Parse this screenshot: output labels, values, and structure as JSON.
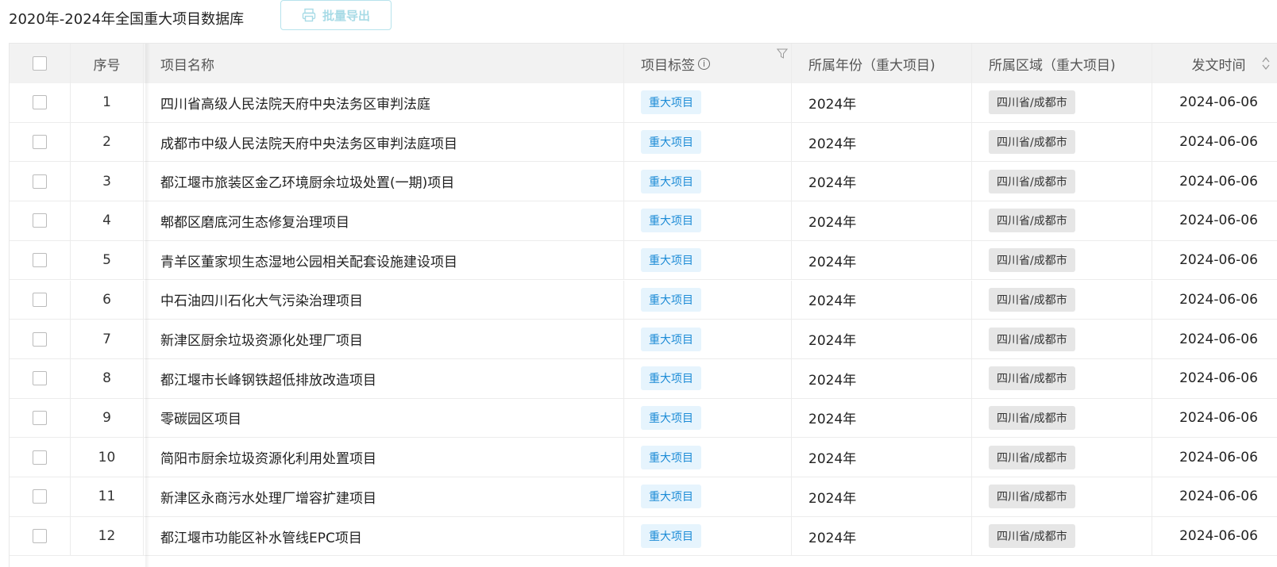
{
  "page": {
    "title": "2020年-2024年全国重大项目数据库",
    "export_label": "批量导出"
  },
  "table": {
    "headers": {
      "index": "序号",
      "name": "项目名称",
      "tag": "项目标签",
      "year": "所属年份（重大项目)",
      "region": "所属区域（重大项目)",
      "date": "发文时间"
    },
    "rows": [
      {
        "index": "1",
        "name": "四川省高级人民法院天府中央法务区审判法庭",
        "tag": "重大项目",
        "year": "2024年",
        "region": "四川省/成都市",
        "date": "2024-06-06"
      },
      {
        "index": "2",
        "name": "成都市中级人民法院天府中央法务区审判法庭项目",
        "tag": "重大项目",
        "year": "2024年",
        "region": "四川省/成都市",
        "date": "2024-06-06"
      },
      {
        "index": "3",
        "name": "都江堰市旅装区金乙环境厨余垃圾处置(一期)项目",
        "tag": "重大项目",
        "year": "2024年",
        "region": "四川省/成都市",
        "date": "2024-06-06"
      },
      {
        "index": "4",
        "name": "郫都区磨底河生态修复治理项目",
        "tag": "重大项目",
        "year": "2024年",
        "region": "四川省/成都市",
        "date": "2024-06-06"
      },
      {
        "index": "5",
        "name": "青羊区董家坝生态湿地公园相关配套设施建设项目",
        "tag": "重大项目",
        "year": "2024年",
        "region": "四川省/成都市",
        "date": "2024-06-06"
      },
      {
        "index": "6",
        "name": "中石油四川石化大气污染治理项目",
        "tag": "重大项目",
        "year": "2024年",
        "region": "四川省/成都市",
        "date": "2024-06-06"
      },
      {
        "index": "7",
        "name": "新津区厨余垃圾资源化处理厂项目",
        "tag": "重大项目",
        "year": "2024年",
        "region": "四川省/成都市",
        "date": "2024-06-06"
      },
      {
        "index": "8",
        "name": "都江堰市长峰钢铁超低排放改造项目",
        "tag": "重大项目",
        "year": "2024年",
        "region": "四川省/成都市",
        "date": "2024-06-06"
      },
      {
        "index": "9",
        "name": "零碳园区项目",
        "tag": "重大项目",
        "year": "2024年",
        "region": "四川省/成都市",
        "date": "2024-06-06"
      },
      {
        "index": "10",
        "name": "简阳市厨余垃圾资源化利用处置项目",
        "tag": "重大项目",
        "year": "2024年",
        "region": "四川省/成都市",
        "date": "2024-06-06"
      },
      {
        "index": "11",
        "name": "新津区永商污水处理厂增容扩建项目",
        "tag": "重大项目",
        "year": "2024年",
        "region": "四川省/成都市",
        "date": "2024-06-06"
      },
      {
        "index": "12",
        "name": "都江堰市功能区补水管线EPC项目",
        "tag": "重大项目",
        "year": "2024年",
        "region": "四川省/成都市",
        "date": "2024-06-06"
      }
    ]
  },
  "colors": {
    "tag_bg": "#e6f4fd",
    "tag_text": "#1c8bd6",
    "region_bg": "#e6e6e6",
    "export_text": "#a8dbe6"
  },
  "icons": {
    "export": "printer-icon",
    "tag_info": "info-circle-icon",
    "tag_filter": "filter-icon",
    "date_sort": "sort-icon"
  }
}
